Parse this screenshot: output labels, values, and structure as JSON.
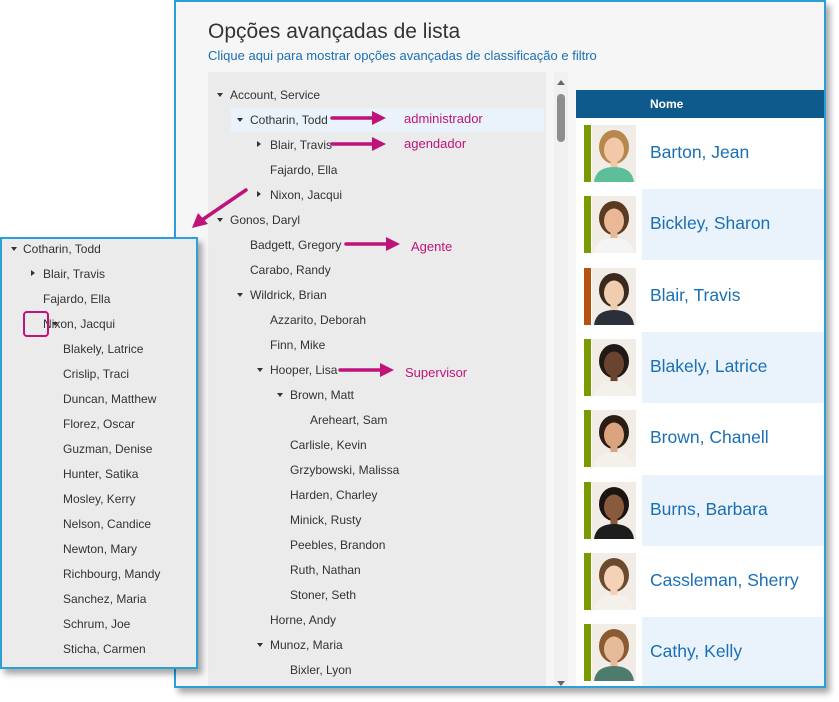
{
  "header": {
    "title": "Opções avançadas de lista",
    "subtitle": "Clique aqui para mostrar opções avançadas de classificação e filtro"
  },
  "tree": [
    {
      "label": "Account, Service",
      "state": "expanded"
    },
    {
      "label": "Cotharin, Todd",
      "state": "expanded",
      "selected": true
    },
    {
      "label": "Blair, Travis",
      "state": "collapsed"
    },
    {
      "label": "Fajardo, Ella",
      "state": "leaf"
    },
    {
      "label": "Nixon, Jacqui",
      "state": "collapsed"
    },
    {
      "label": "Gonos, Daryl",
      "state": "expanded"
    },
    {
      "label": "Badgett, Gregory",
      "state": "leaf"
    },
    {
      "label": "Carabo, Randy",
      "state": "leaf"
    },
    {
      "label": "Wildrick, Brian",
      "state": "expanded"
    },
    {
      "label": "Azzarito, Deborah",
      "state": "leaf"
    },
    {
      "label": "Finn, Mike",
      "state": "leaf"
    },
    {
      "label": "Hooper, Lisa",
      "state": "expanded"
    },
    {
      "label": "Brown, Matt",
      "state": "expanded"
    },
    {
      "label": "Areheart, Sam",
      "state": "leaf"
    },
    {
      "label": "Carlisle, Kevin",
      "state": "leaf"
    },
    {
      "label": "Grzybowski, Malissa",
      "state": "leaf"
    },
    {
      "label": "Harden, Charley",
      "state": "leaf"
    },
    {
      "label": "Minick, Rusty",
      "state": "leaf"
    },
    {
      "label": "Peebles, Brandon",
      "state": "leaf"
    },
    {
      "label": "Ruth, Nathan",
      "state": "leaf"
    },
    {
      "label": "Stoner, Seth",
      "state": "leaf"
    },
    {
      "label": "Horne, Andy",
      "state": "leaf"
    },
    {
      "label": "Munoz, Maria",
      "state": "expanded"
    },
    {
      "label": "Bixler, Lyon",
      "state": "leaf"
    }
  ],
  "grid": {
    "column_header": "Nome",
    "rows": [
      {
        "name": "Barton, Jean",
        "status_color": "#7a9a01"
      },
      {
        "name": "Bickley, Sharon",
        "status_color": "#7a9a01"
      },
      {
        "name": "Blair, Travis",
        "status_color": "#b5520f"
      },
      {
        "name": "Blakely, Latrice",
        "status_color": "#7a9a01"
      },
      {
        "name": "Brown, Chanell",
        "status_color": "#7a9a01"
      },
      {
        "name": "Burns, Barbara",
        "status_color": "#7a9a01"
      },
      {
        "name": "Cassleman, Sherry",
        "status_color": "#7a9a01"
      },
      {
        "name": "Cathy, Kelly",
        "status_color": "#7a9a01"
      }
    ]
  },
  "annotations": [
    {
      "label": "administrador"
    },
    {
      "label": "agendador"
    },
    {
      "label": "Agente"
    },
    {
      "label": "Supervisor"
    }
  ],
  "zoom_tree": [
    {
      "label": "Cotharin, Todd",
      "state": "expanded"
    },
    {
      "label": "Blair, Travis",
      "state": "collapsed"
    },
    {
      "label": "Fajardo, Ella",
      "state": "leaf"
    },
    {
      "label": "Nixon, Jacqui",
      "state": "expanded"
    },
    {
      "label": "Blakely, Latrice",
      "state": "leaf"
    },
    {
      "label": "Crislip, Traci",
      "state": "leaf"
    },
    {
      "label": "Duncan, Matthew",
      "state": "leaf"
    },
    {
      "label": "Florez, Oscar",
      "state": "leaf"
    },
    {
      "label": "Guzman, Denise",
      "state": "leaf"
    },
    {
      "label": "Hunter, Satika",
      "state": "leaf"
    },
    {
      "label": "Mosley, Kerry",
      "state": "leaf"
    },
    {
      "label": "Nelson, Candice",
      "state": "leaf"
    },
    {
      "label": "Newton, Mary",
      "state": "leaf"
    },
    {
      "label": "Richbourg, Mandy",
      "state": "leaf"
    },
    {
      "label": "Sanchez, Maria",
      "state": "leaf"
    },
    {
      "label": "Schrum, Joe",
      "state": "leaf"
    },
    {
      "label": "Sticha, Carmen",
      "state": "leaf"
    }
  ],
  "colors": {
    "accent_border": "#2a9fd8",
    "header_bg": "#0f5a8c",
    "link": "#1a6fb5",
    "annotation": "#c0137a",
    "status_available": "#7a9a01",
    "status_busy": "#b5520f"
  }
}
